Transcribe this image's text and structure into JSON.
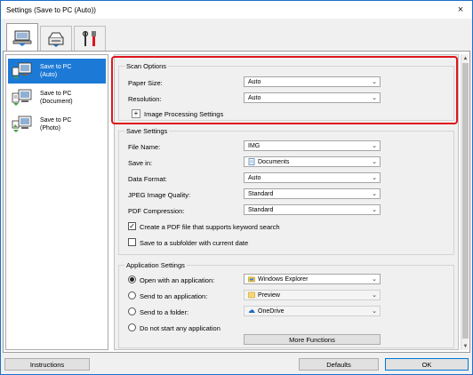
{
  "window": {
    "title": "Settings (Save to PC (Auto))",
    "close_icon": "×"
  },
  "tabs": [
    {
      "icon": "scan-from-computer-icon",
      "active": true
    },
    {
      "icon": "scan-from-operation-panel-icon",
      "active": false
    },
    {
      "icon": "general-settings-icon",
      "active": false
    }
  ],
  "sidebar": {
    "items": [
      {
        "label_line1": "Save to PC",
        "label_line2": "(Auto)",
        "icon": "save-to-pc-auto-icon",
        "selected": true
      },
      {
        "label_line1": "Save to PC",
        "label_line2": "(Document)",
        "icon": "save-to-pc-document-icon",
        "selected": false
      },
      {
        "label_line1": "Save to PC",
        "label_line2": "(Photo)",
        "icon": "save-to-pc-photo-icon",
        "selected": false
      }
    ]
  },
  "scan_options": {
    "title": "Scan Options",
    "paper_size_label": "Paper Size:",
    "paper_size_value": "Auto",
    "resolution_label": "Resolution:",
    "resolution_value": "Auto",
    "image_processing_label": "Image Processing Settings",
    "expand_symbol": "+"
  },
  "save_settings": {
    "title": "Save Settings",
    "file_name_label": "File Name:",
    "file_name_value": "IMG",
    "save_in_label": "Save in:",
    "save_in_value": "Documents",
    "data_format_label": "Data Format:",
    "data_format_value": "Auto",
    "jpeg_quality_label": "JPEG Image Quality:",
    "jpeg_quality_value": "Standard",
    "pdf_compression_label": "PDF Compression:",
    "pdf_compression_value": "Standard",
    "keyword_pdf_label": "Create a PDF file that supports keyword search",
    "keyword_pdf_checked": true,
    "subfolder_label": "Save to a subfolder with current date",
    "subfolder_checked": false,
    "check_mark": "✓"
  },
  "application_settings": {
    "title": "Application Settings",
    "open_with_label": "Open with an application:",
    "open_with_value": "Windows Explorer",
    "send_to_app_label": "Send to an application:",
    "send_to_app_value": "Preview",
    "send_to_folder_label": "Send to a folder:",
    "send_to_folder_value": "OneDrive",
    "do_not_start_label": "Do not start any application",
    "selected_option": "open_with",
    "more_functions_label": "More Functions"
  },
  "footer": {
    "instructions_label": "Instructions",
    "defaults_label": "Defaults",
    "ok_label": "OK"
  },
  "colors": {
    "selection_blue": "#1c7ad6",
    "highlight_red": "#e0151c",
    "window_border": "#1e6fc9"
  }
}
